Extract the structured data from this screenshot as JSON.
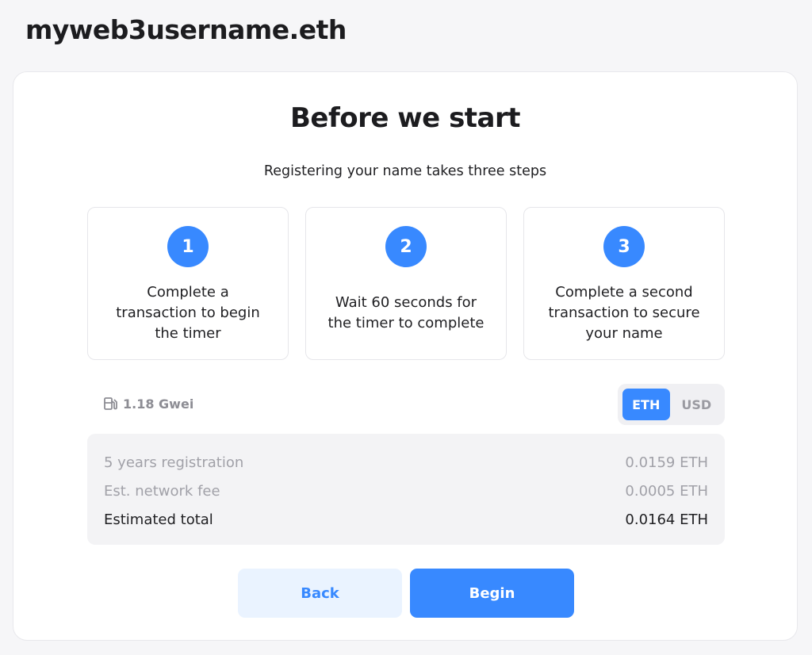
{
  "header": {
    "name": "myweb3username.eth"
  },
  "card": {
    "title": "Before we start",
    "subtitle": "Registering your name takes three steps",
    "steps": [
      {
        "number": "1",
        "text": "Complete a\ntransaction to begin\nthe timer"
      },
      {
        "number": "2",
        "text": "Wait 60 seconds for\nthe timer to complete"
      },
      {
        "number": "3",
        "text": "Complete a second\ntransaction to secure\nyour name"
      }
    ]
  },
  "gas": {
    "icon": "gas-pump-icon",
    "value": "1.18 Gwei"
  },
  "currency": {
    "options": [
      "ETH",
      "USD"
    ],
    "selected": "ETH"
  },
  "summary": {
    "rows": [
      {
        "label": "5 years registration",
        "value": "0.0159 ETH"
      },
      {
        "label": "Est. network fee",
        "value": "0.0005 ETH"
      },
      {
        "label": "Estimated total",
        "value": "0.0164 ETH"
      }
    ]
  },
  "actions": {
    "back_label": "Back",
    "begin_label": "Begin"
  },
  "colors": {
    "accent": "#3889ff",
    "accent_light": "#eaf3ff",
    "muted": "#a1a1a8"
  }
}
